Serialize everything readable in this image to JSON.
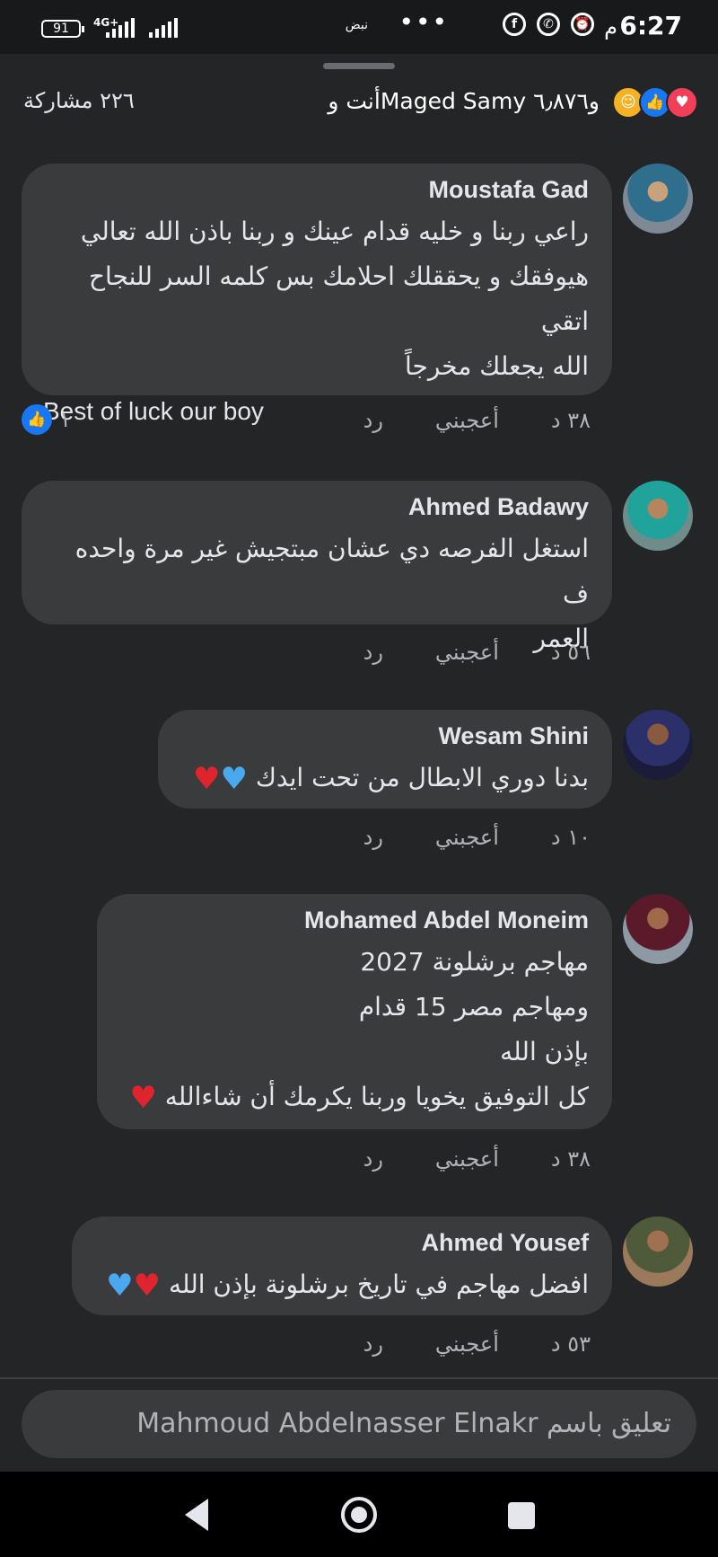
{
  "status_bar": {
    "time": "6:27",
    "am_pm": "م",
    "battery": "91",
    "network": "4G+",
    "nabd_label": "نبض",
    "dots": "•••",
    "icons": [
      "alarm-icon",
      "whatsapp-icon",
      "facebook-icon"
    ]
  },
  "reactions_summary": {
    "text": "أنت وMaged Samy و٦٫٨٧٦",
    "shares": "٢٢٦ مشاركة",
    "icons": [
      "heart-reaction-icon",
      "like-reaction-icon",
      "care-reaction-icon"
    ]
  },
  "comments": [
    {
      "name": "Moustafa Gad",
      "lines": [
        "راعي ربنا و خليه قدام عينك و ربنا باذن الله تعالي",
        "هيوفقك و يحققلك احلامك بس كلمه السر للنجاح اتقي",
        "الله يجعلك مخرجاً",
        "Best of luck our boy"
      ],
      "time": "٣٨ د",
      "like": "أعجبني",
      "reply": "رد",
      "like_count": "١"
    },
    {
      "name": "Ahmed Badawy",
      "lines": [
        "استغل الفرصه دي عشان مبتجيش غير مرة واحده ف",
        "العمر"
      ],
      "time": "٥٦ د",
      "like": "أعجبني",
      "reply": "رد"
    },
    {
      "name": "Wesam Shini",
      "lines": [
        "بدنا دوري الابطال من تحت ايدك"
      ],
      "time": "١٠ د",
      "like": "أعجبني",
      "reply": "رد"
    },
    {
      "name": "Mohamed Abdel Moneim",
      "lines": [
        "مهاجم برشلونة 2027",
        "ومهاجم مصر 15 قدام",
        "بإذن الله",
        "كل التوفيق يخويا وربنا يكرمك أن شاءالله"
      ],
      "time": "٣٨ د",
      "like": "أعجبني",
      "reply": "رد"
    },
    {
      "name": "Ahmed Yousef",
      "lines": [
        "افضل مهاجم في تاريخ برشلونة بإذن الله"
      ],
      "time": "٥٣ د",
      "like": "أعجبني",
      "reply": "رد"
    }
  ],
  "composer": {
    "placeholder": "تعليق باسم Mahmoud Abdelnasser Elnakr"
  },
  "colors": {
    "background": "#242526",
    "bubble": "#3a3b3c",
    "like_blue": "#1877f2",
    "heart_red": "#f33e58"
  }
}
